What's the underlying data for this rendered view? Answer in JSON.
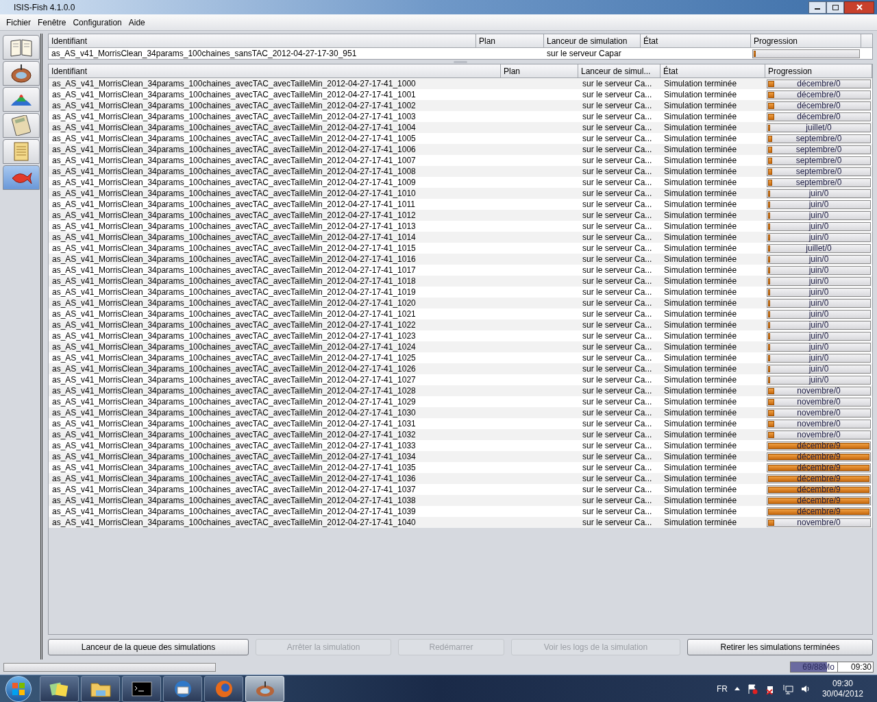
{
  "window": {
    "title": "ISIS-Fish 4.1.0.0"
  },
  "menu": [
    "Fichier",
    "Fenêtre",
    "Configuration",
    "Aide"
  ],
  "sidebar": {
    "items": [
      {
        "kind": "book",
        "selected": false
      },
      {
        "kind": "globe",
        "selected": false
      },
      {
        "kind": "surface",
        "selected": false
      },
      {
        "kind": "calculator",
        "selected": false
      },
      {
        "kind": "notepad",
        "selected": false
      },
      {
        "kind": "fish",
        "selected": true
      }
    ]
  },
  "queue_table": {
    "columns": [
      "Identifiant",
      "Plan",
      "Lanceur de simulation",
      "État",
      "Progression"
    ],
    "rows": [
      {
        "id": "as_AS_v41_MorrisClean_34params_100chaines_sansTAC_2012-04-27-17-30_951",
        "launcher": "sur le serveur Capar",
        "level": 0
      }
    ]
  },
  "table": {
    "columns": [
      "Identifiant",
      "Plan",
      "Lanceur de simul...",
      "État",
      "Progression"
    ],
    "rows": [
      {
        "id": "as_AS_v41_MorrisClean_34params_100chaines_avecTAC_avecTailleMin_2012-04-27-17-41_1000",
        "launcher": "sur le serveur Ca...",
        "state": "Simulation terminée",
        "progress": "décembre/0",
        "level": 0.07
      },
      {
        "id": "as_AS_v41_MorrisClean_34params_100chaines_avecTAC_avecTailleMin_2012-04-27-17-41_1001",
        "launcher": "sur le serveur Ca...",
        "state": "Simulation terminée",
        "progress": "décembre/0",
        "level": 0.07
      },
      {
        "id": "as_AS_v41_MorrisClean_34params_100chaines_avecTAC_avecTailleMin_2012-04-27-17-41_1002",
        "launcher": "sur le serveur Ca...",
        "state": "Simulation terminée",
        "progress": "décembre/0",
        "level": 0.07
      },
      {
        "id": "as_AS_v41_MorrisClean_34params_100chaines_avecTAC_avecTailleMin_2012-04-27-17-41_1003",
        "launcher": "sur le serveur Ca...",
        "state": "Simulation terminée",
        "progress": "décembre/0",
        "level": 0.07
      },
      {
        "id": "as_AS_v41_MorrisClean_34params_100chaines_avecTAC_avecTailleMin_2012-04-27-17-41_1004",
        "launcher": "sur le serveur Ca...",
        "state": "Simulation terminée",
        "progress": "juillet/0",
        "level": 0.03
      },
      {
        "id": "as_AS_v41_MorrisClean_34params_100chaines_avecTAC_avecTailleMin_2012-04-27-17-41_1005",
        "launcher": "sur le serveur Ca...",
        "state": "Simulation terminée",
        "progress": "septembre/0",
        "level": 0.05
      },
      {
        "id": "as_AS_v41_MorrisClean_34params_100chaines_avecTAC_avecTailleMin_2012-04-27-17-41_1006",
        "launcher": "sur le serveur Ca...",
        "state": "Simulation terminée",
        "progress": "septembre/0",
        "level": 0.05
      },
      {
        "id": "as_AS_v41_MorrisClean_34params_100chaines_avecTAC_avecTailleMin_2012-04-27-17-41_1007",
        "launcher": "sur le serveur Ca...",
        "state": "Simulation terminée",
        "progress": "septembre/0",
        "level": 0.05
      },
      {
        "id": "as_AS_v41_MorrisClean_34params_100chaines_avecTAC_avecTailleMin_2012-04-27-17-41_1008",
        "launcher": "sur le serveur Ca...",
        "state": "Simulation terminée",
        "progress": "septembre/0",
        "level": 0.05
      },
      {
        "id": "as_AS_v41_MorrisClean_34params_100chaines_avecTAC_avecTailleMin_2012-04-27-17-41_1009",
        "launcher": "sur le serveur Ca...",
        "state": "Simulation terminée",
        "progress": "septembre/0",
        "level": 0.05
      },
      {
        "id": "as_AS_v41_MorrisClean_34params_100chaines_avecTAC_avecTailleMin_2012-04-27-17-41_1010",
        "launcher": "sur le serveur Ca...",
        "state": "Simulation terminée",
        "progress": "juin/0",
        "level": 0.02
      },
      {
        "id": "as_AS_v41_MorrisClean_34params_100chaines_avecTAC_avecTailleMin_2012-04-27-17-41_1011",
        "launcher": "sur le serveur Ca...",
        "state": "Simulation terminée",
        "progress": "juin/0",
        "level": 0.02
      },
      {
        "id": "as_AS_v41_MorrisClean_34params_100chaines_avecTAC_avecTailleMin_2012-04-27-17-41_1012",
        "launcher": "sur le serveur Ca...",
        "state": "Simulation terminée",
        "progress": "juin/0",
        "level": 0.02
      },
      {
        "id": "as_AS_v41_MorrisClean_34params_100chaines_avecTAC_avecTailleMin_2012-04-27-17-41_1013",
        "launcher": "sur le serveur Ca...",
        "state": "Simulation terminée",
        "progress": "juin/0",
        "level": 0.02
      },
      {
        "id": "as_AS_v41_MorrisClean_34params_100chaines_avecTAC_avecTailleMin_2012-04-27-17-41_1014",
        "launcher": "sur le serveur Ca...",
        "state": "Simulation terminée",
        "progress": "juin/0",
        "level": 0.02
      },
      {
        "id": "as_AS_v41_MorrisClean_34params_100chaines_avecTAC_avecTailleMin_2012-04-27-17-41_1015",
        "launcher": "sur le serveur Ca...",
        "state": "Simulation terminée",
        "progress": "juillet/0",
        "level": 0.03
      },
      {
        "id": "as_AS_v41_MorrisClean_34params_100chaines_avecTAC_avecTailleMin_2012-04-27-17-41_1016",
        "launcher": "sur le serveur Ca...",
        "state": "Simulation terminée",
        "progress": "juin/0",
        "level": 0.02
      },
      {
        "id": "as_AS_v41_MorrisClean_34params_100chaines_avecTAC_avecTailleMin_2012-04-27-17-41_1017",
        "launcher": "sur le serveur Ca...",
        "state": "Simulation terminée",
        "progress": "juin/0",
        "level": 0.02
      },
      {
        "id": "as_AS_v41_MorrisClean_34params_100chaines_avecTAC_avecTailleMin_2012-04-27-17-41_1018",
        "launcher": "sur le serveur Ca...",
        "state": "Simulation terminée",
        "progress": "juin/0",
        "level": 0.02
      },
      {
        "id": "as_AS_v41_MorrisClean_34params_100chaines_avecTAC_avecTailleMin_2012-04-27-17-41_1019",
        "launcher": "sur le serveur Ca...",
        "state": "Simulation terminée",
        "progress": "juin/0",
        "level": 0.02
      },
      {
        "id": "as_AS_v41_MorrisClean_34params_100chaines_avecTAC_avecTailleMin_2012-04-27-17-41_1020",
        "launcher": "sur le serveur Ca...",
        "state": "Simulation terminée",
        "progress": "juin/0",
        "level": 0.02
      },
      {
        "id": "as_AS_v41_MorrisClean_34params_100chaines_avecTAC_avecTailleMin_2012-04-27-17-41_1021",
        "launcher": "sur le serveur Ca...",
        "state": "Simulation terminée",
        "progress": "juin/0",
        "level": 0.02
      },
      {
        "id": "as_AS_v41_MorrisClean_34params_100chaines_avecTAC_avecTailleMin_2012-04-27-17-41_1022",
        "launcher": "sur le serveur Ca...",
        "state": "Simulation terminée",
        "progress": "juin/0",
        "level": 0.02
      },
      {
        "id": "as_AS_v41_MorrisClean_34params_100chaines_avecTAC_avecTailleMin_2012-04-27-17-41_1023",
        "launcher": "sur le serveur Ca...",
        "state": "Simulation terminée",
        "progress": "juin/0",
        "level": 0.02
      },
      {
        "id": "as_AS_v41_MorrisClean_34params_100chaines_avecTAC_avecTailleMin_2012-04-27-17-41_1024",
        "launcher": "sur le serveur Ca...",
        "state": "Simulation terminée",
        "progress": "juin/0",
        "level": 0.02
      },
      {
        "id": "as_AS_v41_MorrisClean_34params_100chaines_avecTAC_avecTailleMin_2012-04-27-17-41_1025",
        "launcher": "sur le serveur Ca...",
        "state": "Simulation terminée",
        "progress": "juin/0",
        "level": 0.02
      },
      {
        "id": "as_AS_v41_MorrisClean_34params_100chaines_avecTAC_avecTailleMin_2012-04-27-17-41_1026",
        "launcher": "sur le serveur Ca...",
        "state": "Simulation terminée",
        "progress": "juin/0",
        "level": 0.02
      },
      {
        "id": "as_AS_v41_MorrisClean_34params_100chaines_avecTAC_avecTailleMin_2012-04-27-17-41_1027",
        "launcher": "sur le serveur Ca...",
        "state": "Simulation terminée",
        "progress": "juin/0",
        "level": 0.02
      },
      {
        "id": "as_AS_v41_MorrisClean_34params_100chaines_avecTAC_avecTailleMin_2012-04-27-17-41_1028",
        "launcher": "sur le serveur Ca...",
        "state": "Simulation terminée",
        "progress": "novembre/0",
        "level": 0.07
      },
      {
        "id": "as_AS_v41_MorrisClean_34params_100chaines_avecTAC_avecTailleMin_2012-04-27-17-41_1029",
        "launcher": "sur le serveur Ca...",
        "state": "Simulation terminée",
        "progress": "novembre/0",
        "level": 0.07
      },
      {
        "id": "as_AS_v41_MorrisClean_34params_100chaines_avecTAC_avecTailleMin_2012-04-27-17-41_1030",
        "launcher": "sur le serveur Ca...",
        "state": "Simulation terminée",
        "progress": "novembre/0",
        "level": 0.07
      },
      {
        "id": "as_AS_v41_MorrisClean_34params_100chaines_avecTAC_avecTailleMin_2012-04-27-17-41_1031",
        "launcher": "sur le serveur Ca...",
        "state": "Simulation terminée",
        "progress": "novembre/0",
        "level": 0.07
      },
      {
        "id": "as_AS_v41_MorrisClean_34params_100chaines_avecTAC_avecTailleMin_2012-04-27-17-41_1032",
        "launcher": "sur le serveur Ca...",
        "state": "Simulation terminée",
        "progress": "novembre/0",
        "level": 0.07
      },
      {
        "id": "as_AS_v41_MorrisClean_34params_100chaines_avecTAC_avecTailleMin_2012-04-27-17-41_1033",
        "launcher": "sur le serveur Ca...",
        "state": "Simulation terminée",
        "progress": "décembre/9",
        "level": 1
      },
      {
        "id": "as_AS_v41_MorrisClean_34params_100chaines_avecTAC_avecTailleMin_2012-04-27-17-41_1034",
        "launcher": "sur le serveur Ca...",
        "state": "Simulation terminée",
        "progress": "décembre/9",
        "level": 1
      },
      {
        "id": "as_AS_v41_MorrisClean_34params_100chaines_avecTAC_avecTailleMin_2012-04-27-17-41_1035",
        "launcher": "sur le serveur Ca...",
        "state": "Simulation terminée",
        "progress": "décembre/9",
        "level": 1
      },
      {
        "id": "as_AS_v41_MorrisClean_34params_100chaines_avecTAC_avecTailleMin_2012-04-27-17-41_1036",
        "launcher": "sur le serveur Ca...",
        "state": "Simulation terminée",
        "progress": "décembre/9",
        "level": 1
      },
      {
        "id": "as_AS_v41_MorrisClean_34params_100chaines_avecTAC_avecTailleMin_2012-04-27-17-41_1037",
        "launcher": "sur le serveur Ca...",
        "state": "Simulation terminée",
        "progress": "décembre/9",
        "level": 1
      },
      {
        "id": "as_AS_v41_MorrisClean_34params_100chaines_avecTAC_avecTailleMin_2012-04-27-17-41_1038",
        "launcher": "sur le serveur Ca...",
        "state": "Simulation terminée",
        "progress": "décembre/9",
        "level": 1
      },
      {
        "id": "as_AS_v41_MorrisClean_34params_100chaines_avecTAC_avecTailleMin_2012-04-27-17-41_1039",
        "launcher": "sur le serveur Ca...",
        "state": "Simulation terminée",
        "progress": "décembre/9",
        "level": 1
      },
      {
        "id": "as_AS_v41_MorrisClean_34params_100chaines_avecTAC_avecTailleMin_2012-04-27-17-41_1040",
        "launcher": "sur le serveur Ca...",
        "state": "Simulation terminée",
        "progress": "novembre/0",
        "level": 0.07
      }
    ]
  },
  "buttons": [
    {
      "label": "Lanceur de la queue des simulations",
      "disabled": false
    },
    {
      "label": "Arrêter la simulation",
      "disabled": true
    },
    {
      "label": "Redémarrer",
      "disabled": true
    },
    {
      "label": "Voir les logs de la simulation",
      "disabled": true
    },
    {
      "label": "Retirer les simulations terminées",
      "disabled": false
    }
  ],
  "status_bar": {
    "memory": {
      "text": "69/88Mo",
      "level": 0.78
    },
    "time": "09:30"
  },
  "taskbar": {
    "apps": [
      {
        "kind": "windows",
        "selected": false
      },
      {
        "kind": "folder",
        "selected": false
      },
      {
        "kind": "terminal",
        "selected": false
      },
      {
        "kind": "mail",
        "selected": false
      },
      {
        "kind": "browser",
        "selected": false
      },
      {
        "kind": "isis",
        "selected": true
      }
    ],
    "language": "FR",
    "clock_time": "09:30",
    "clock_date": "30/04/2012"
  }
}
